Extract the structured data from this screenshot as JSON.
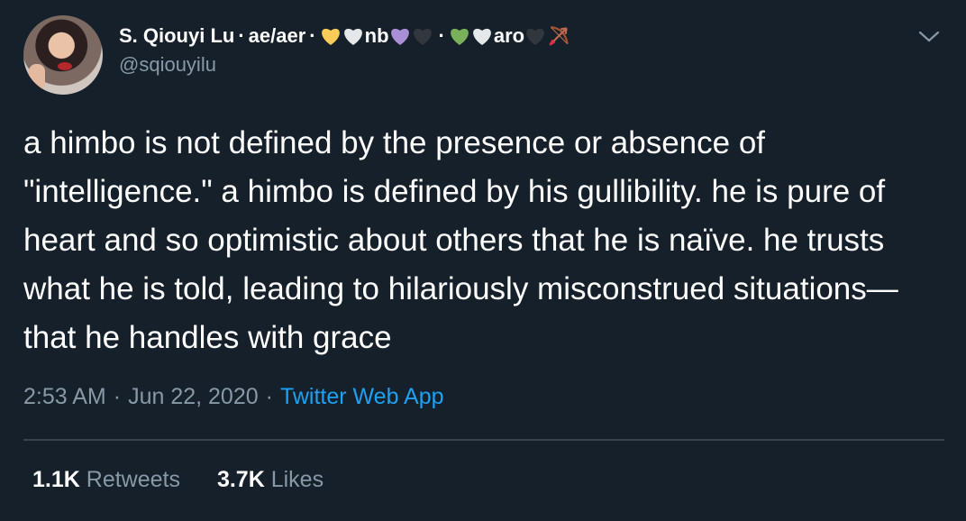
{
  "author": {
    "name": "S. Qiouyi Lu",
    "pronouns": "ae/aer",
    "separator": "·",
    "nb_label": "nb",
    "aro_label": "aro",
    "handle": "@sqiouyilu",
    "flag_icons": {
      "group1": [
        "yellow-heart",
        "white-heart"
      ],
      "group2": [
        "purple-heart",
        "black-heart"
      ],
      "group3": [
        "green-heart",
        "white-heart"
      ],
      "group4": [
        "black-heart",
        "bow-and-arrow"
      ]
    }
  },
  "colors": {
    "background": "#15202b",
    "secondary_text": "#8899a6",
    "link": "#1da1f2",
    "yellow_heart": "#fdcb58",
    "white_heart": "#e6e7e8",
    "purple_heart": "#aa8ed6",
    "black_heart": "#31373d",
    "green_heart": "#78b159"
  },
  "tweet": {
    "text": "a himbo is not defined by the presence or absence of \"intelligence.\" a himbo is defined by his gullibility. he is pure of heart and so optimistic about others that he is naïve. he trusts what he is told, leading to hilariously misconstrued situations—that he handles with grace",
    "time": "2:53 AM",
    "date": "Jun 22, 2020",
    "source": "Twitter Web App",
    "separator": "·"
  },
  "stats": {
    "retweets_count": "1.1K",
    "retweets_label": "Retweets",
    "likes_count": "3.7K",
    "likes_label": "Likes"
  },
  "menu_icon": "chevron-down-icon"
}
